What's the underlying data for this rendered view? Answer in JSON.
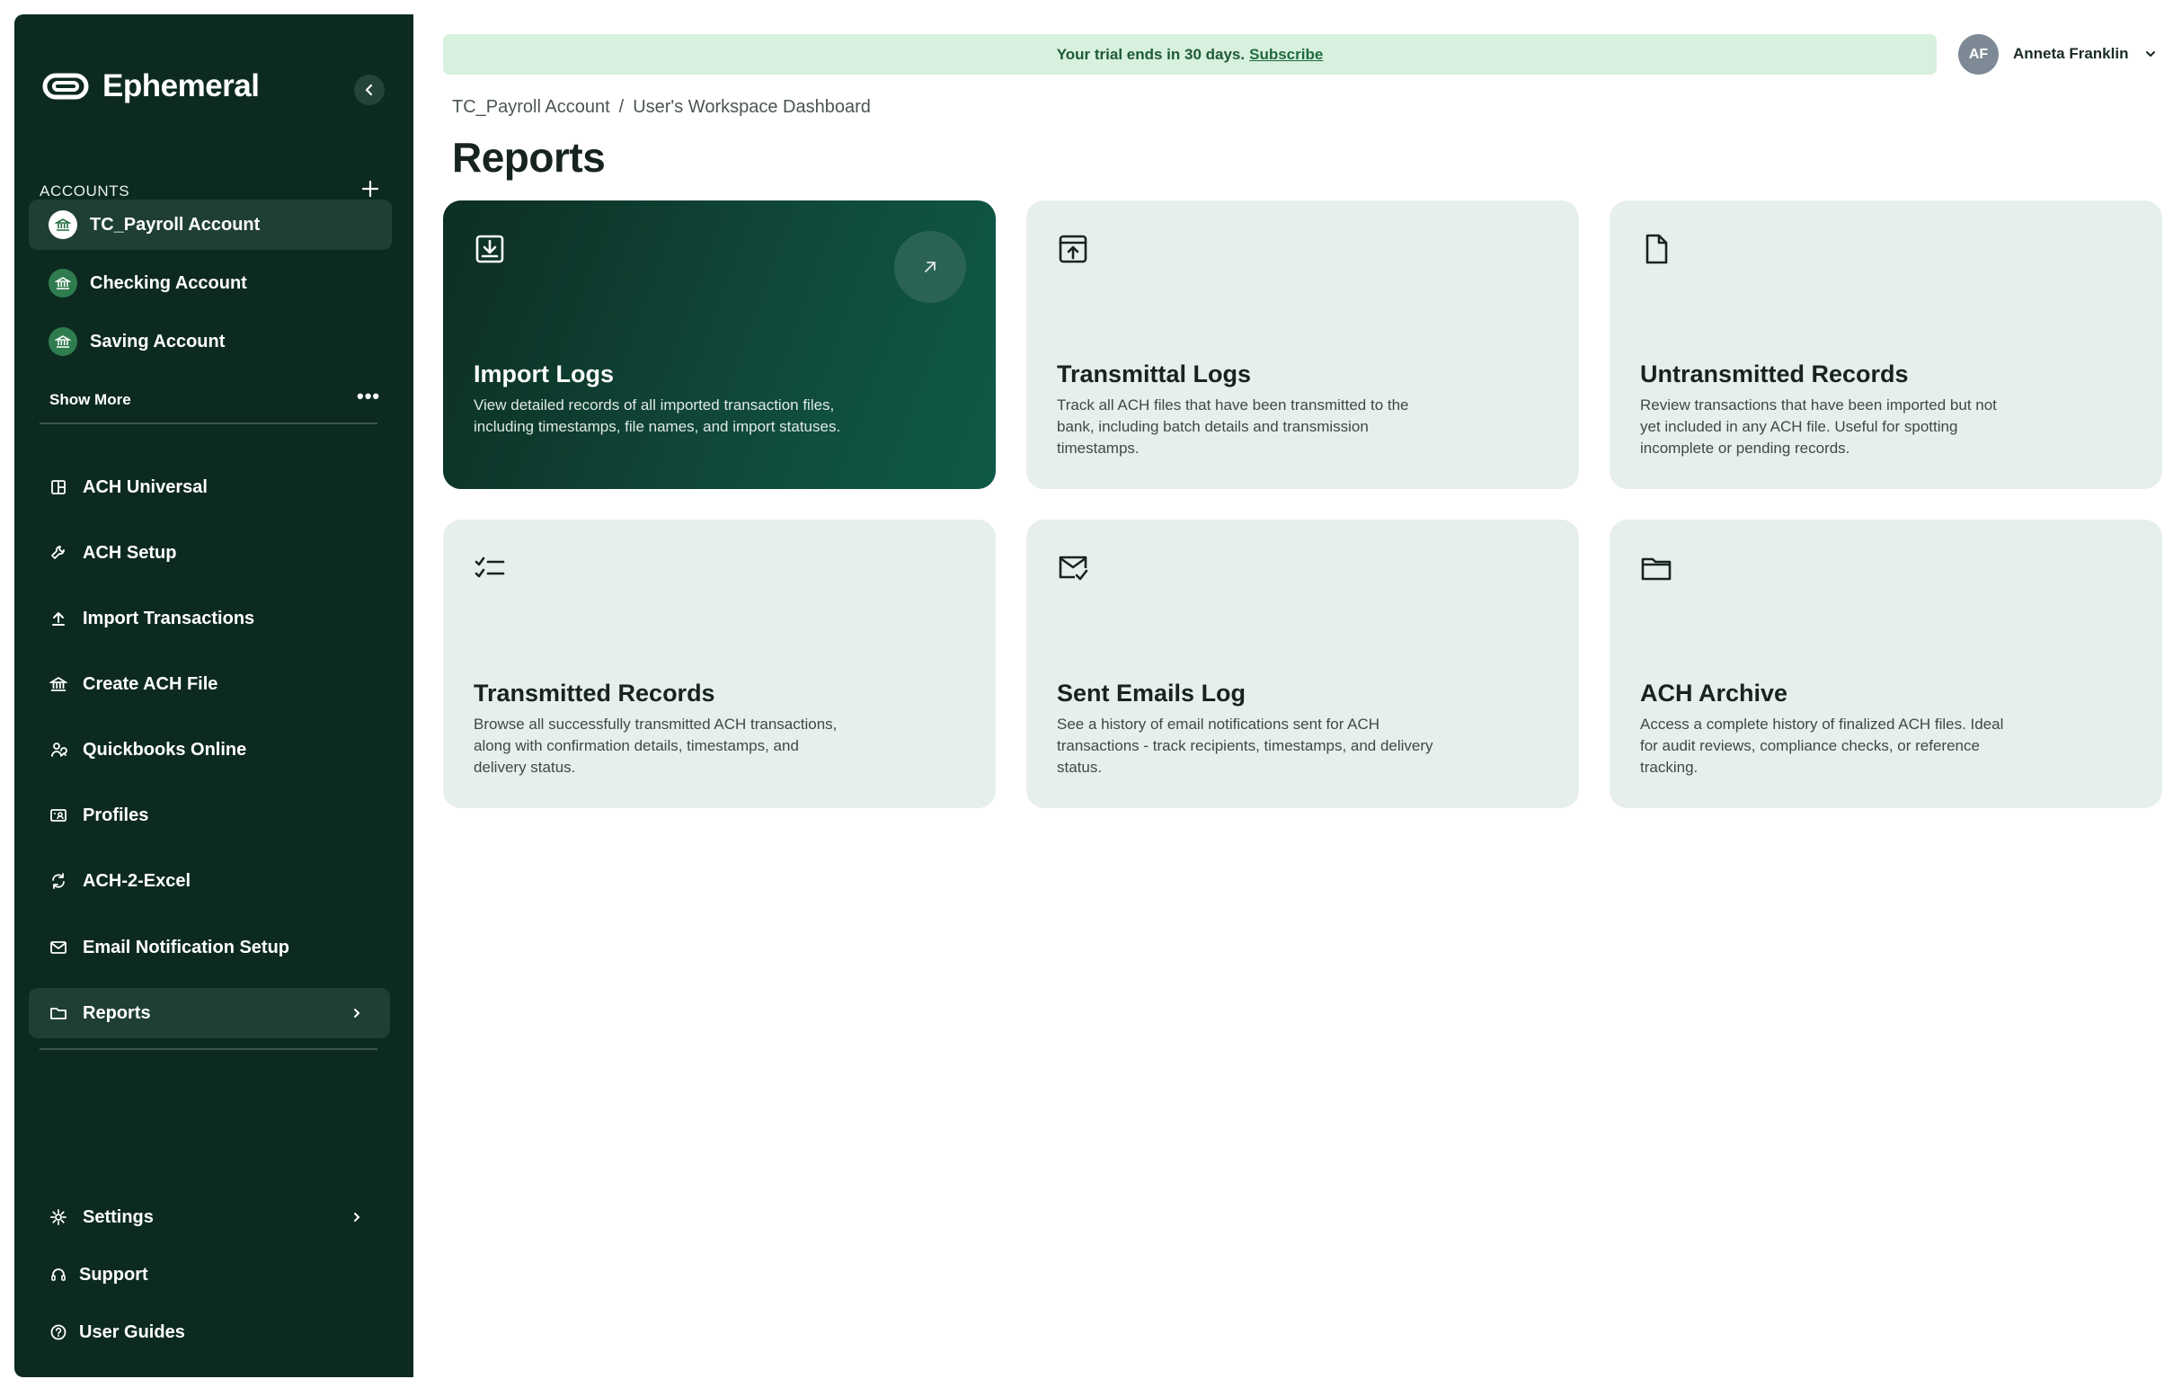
{
  "brand": {
    "name": "Ephemeral"
  },
  "sidebar": {
    "accounts_label": "ACCOUNTS",
    "accounts": [
      {
        "label": "TC_Payroll Account",
        "active": true
      },
      {
        "label": "Checking Account",
        "active": false
      },
      {
        "label": "Saving Account",
        "active": false
      }
    ],
    "show_more": "Show More",
    "more_dots": "•••",
    "nav": [
      {
        "label": "ACH Universal",
        "icon": "grid-icon"
      },
      {
        "label": "ACH Setup",
        "icon": "wrench-icon"
      },
      {
        "label": "Import Transactions",
        "icon": "upload-icon"
      },
      {
        "label": "Create ACH File",
        "icon": "bank-icon"
      },
      {
        "label": "Quickbooks Online",
        "icon": "sync-user-icon"
      },
      {
        "label": "Profiles",
        "icon": "profile-card-icon"
      },
      {
        "label": "ACH-2-Excel",
        "icon": "refresh-icon"
      },
      {
        "label": "Email Notification Setup",
        "icon": "mail-icon"
      },
      {
        "label": "Reports",
        "icon": "folder-icon",
        "active": true
      }
    ],
    "footer": [
      {
        "label": "Settings",
        "icon": "gear-icon"
      },
      {
        "label": "Support",
        "icon": "headset-icon"
      },
      {
        "label": "User Guides",
        "icon": "help-icon"
      }
    ]
  },
  "topbar": {
    "trial_text": "Your trial ends in 30 days.",
    "trial_link": "Subscribe",
    "avatar_initials": "AF",
    "user_name": "Anneta Franklin"
  },
  "breadcrumb": {
    "account": "TC_Payroll Account",
    "separator": "/",
    "page": "User's Workspace Dashboard"
  },
  "page_title": "Reports",
  "cards": [
    {
      "title": "Import Logs",
      "icon": "download-box-icon",
      "featured": true,
      "desc": "View detailed records of all imported transaction files, including timestamps, file names, and import statuses."
    },
    {
      "title": "Transmittal Logs",
      "icon": "upload-box-icon",
      "desc": "Track all ACH files that have been transmitted to the bank, including batch details and transmission timestamps."
    },
    {
      "title": "Untransmitted Records",
      "icon": "file-icon",
      "desc": "Review transactions that have been imported but not yet included in any ACH file. Useful for spotting incomplete or pending records."
    },
    {
      "title": "Transmitted Records",
      "icon": "checklist-icon",
      "desc": "Browse all successfully transmitted ACH transactions, along with confirmation details, timestamps, and delivery status."
    },
    {
      "title": "Sent Emails Log",
      "icon": "mail-check-icon",
      "desc": "See a history of email notifications sent for ACH transactions - track recipients, timestamps, and delivery status."
    },
    {
      "title": "ACH Archive",
      "icon": "folder-icon",
      "desc": "Access a complete history of finalized ACH files. Ideal for audit reviews, compliance checks, or reference tracking."
    }
  ],
  "colors": {
    "sidebar_bg": "#0d2a20",
    "sidebar_active": "#1f3f35",
    "card_bg": "#e7efeb",
    "featured_card": "#104a3b",
    "trial_bg": "#d8f0de",
    "badge_green": "#2f7d4f"
  }
}
